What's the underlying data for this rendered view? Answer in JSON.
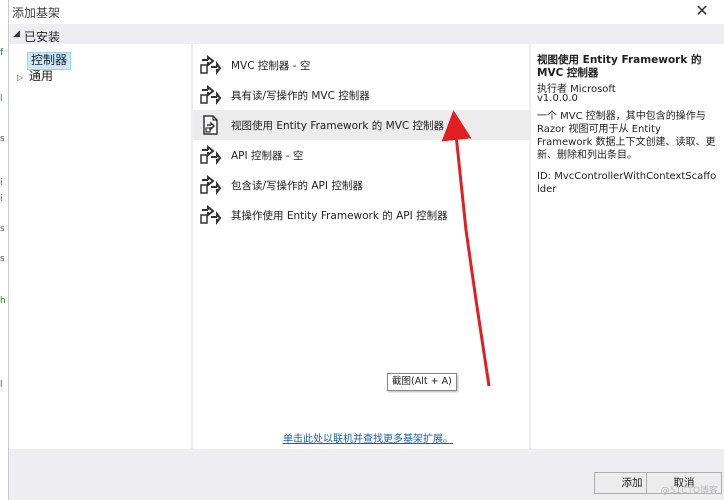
{
  "dialog": {
    "title": "添加基架",
    "close_glyph": "✕"
  },
  "installed": {
    "label": "已安装",
    "items": [
      {
        "label": "控制器"
      },
      {
        "label": "通用"
      }
    ]
  },
  "templates": [
    {
      "label": "MVC 控制器 - 空",
      "icon": "scaffold-icon"
    },
    {
      "label": "具有读/写操作的 MVC 控制器",
      "icon": "scaffold-icon"
    },
    {
      "label": "视图使用 Entity Framework 的 MVC 控制器",
      "icon": "scaffold-doc-icon",
      "selected": true
    },
    {
      "label": "API 控制器 - 空",
      "icon": "scaffold-icon"
    },
    {
      "label": "包含读/写操作的 API 控制器",
      "icon": "scaffold-icon"
    },
    {
      "label": "其操作使用 Entity Framework 的 API 控制器",
      "icon": "scaffold-icon"
    }
  ],
  "more_link": "单击此处以联机并查找更多基架扩展。",
  "description": {
    "title": "视图使用 Entity Framework 的 MVC 控制器",
    "author": "执行者 Microsoft",
    "version": "v1.0.0.0",
    "body": "一个 MVC 控制器，其中包含的操作与 Razor 视图可用于从 Entity Framework 数据上下文创建、读取、更新、删除和列出条目。",
    "id": "ID: MvcControllerWithContextScaffolder"
  },
  "tooltip": "截图(Alt + A)",
  "buttons": {
    "add": "添加",
    "cancel": "取消"
  },
  "editor_marks": [
    "f",
    "l",
    "s",
    "i",
    "i",
    "s",
    "s",
    "h",
    "l"
  ],
  "colors": {
    "selection_bg": "#cce8ff",
    "selected_row": "#ececec",
    "link": "#1a5fb4",
    "annotation_arrow": "#e02020"
  },
  "watermark": "@51CTO博客"
}
